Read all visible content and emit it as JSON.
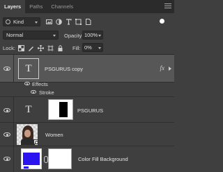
{
  "tabs": [
    {
      "label": "Layers",
      "active": true
    },
    {
      "label": "Paths",
      "active": false
    },
    {
      "label": "Channels",
      "active": false
    }
  ],
  "filter": {
    "kind_label": "Kind",
    "icons": [
      "image-filter-icon",
      "adjustment-filter-icon",
      "type-filter-icon",
      "shape-filter-icon",
      "smart-object-filter-icon",
      "filter-toggle-icon"
    ]
  },
  "blend": {
    "mode": "Normal",
    "opacity_label": "Opacity:",
    "opacity_value": "100%"
  },
  "lock": {
    "label": "Lock:",
    "fill_label": "Fill:",
    "fill_value": "0%"
  },
  "layers": [
    {
      "name": "PSGURUS copy",
      "type": "text",
      "selected": true,
      "fx": "fx",
      "effects_label": "Effects",
      "stroke_label": "Stroke"
    },
    {
      "name": "PSGURUS",
      "type": "text",
      "selected": false
    },
    {
      "name": "Women",
      "type": "smart-object",
      "selected": false
    },
    {
      "name": "Color Fill Background",
      "type": "fill",
      "selected": false
    }
  ],
  "colors": {
    "fill_layer": "#2a14f0",
    "selected_row": "#575757",
    "panel_bg": "#3f3f3f"
  }
}
